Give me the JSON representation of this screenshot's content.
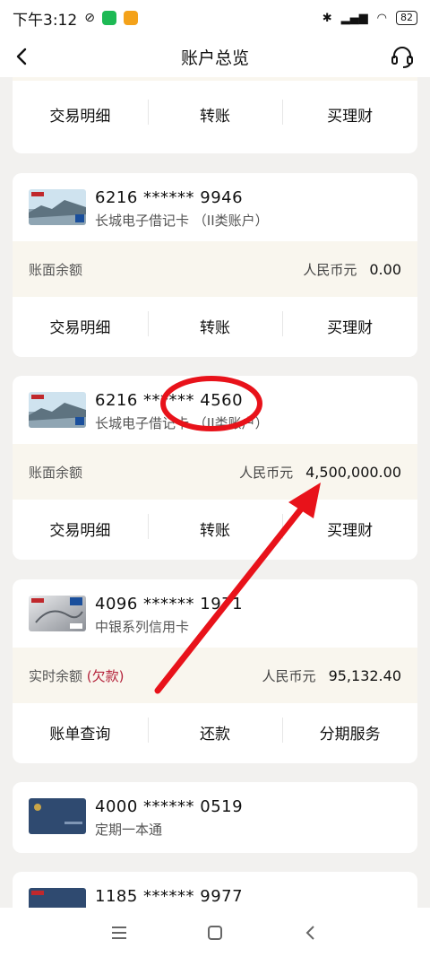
{
  "status": {
    "time": "下午3:12",
    "battery": "82"
  },
  "header": {
    "title": "账户总览"
  },
  "cards": [
    {
      "actions": [
        "交易明细",
        "转账",
        "买理财"
      ]
    },
    {
      "number": "6216 ****** 9946",
      "name": "长城电子借记卡 （II类账户）",
      "balance_label": "账面余额",
      "currency": "人民币元",
      "amount": "0.00",
      "actions": [
        "交易明细",
        "转账",
        "买理财"
      ]
    },
    {
      "number": "6216 ****** 4560",
      "name": "长城电子借记卡 （II类账户）",
      "balance_label": "账面余额",
      "currency": "人民币元",
      "amount": "4,500,000.00",
      "actions": [
        "交易明细",
        "转账",
        "买理财"
      ]
    },
    {
      "number": "4096 ****** 1971",
      "name": "中银系列信用卡",
      "balance_label": "实时余额",
      "debt_label": "(欠款)",
      "currency": "人民币元",
      "amount": "95,132.40",
      "actions": [
        "账单查询",
        "还款",
        "分期服务"
      ]
    },
    {
      "number": "4000 ****** 0519",
      "name": "定期一本通"
    },
    {
      "number": "1185 ****** 9977"
    }
  ],
  "colors": {
    "accent_red": "#e8121a",
    "debt_red": "#b4233b",
    "balance_bg": "#f9f6ee"
  }
}
